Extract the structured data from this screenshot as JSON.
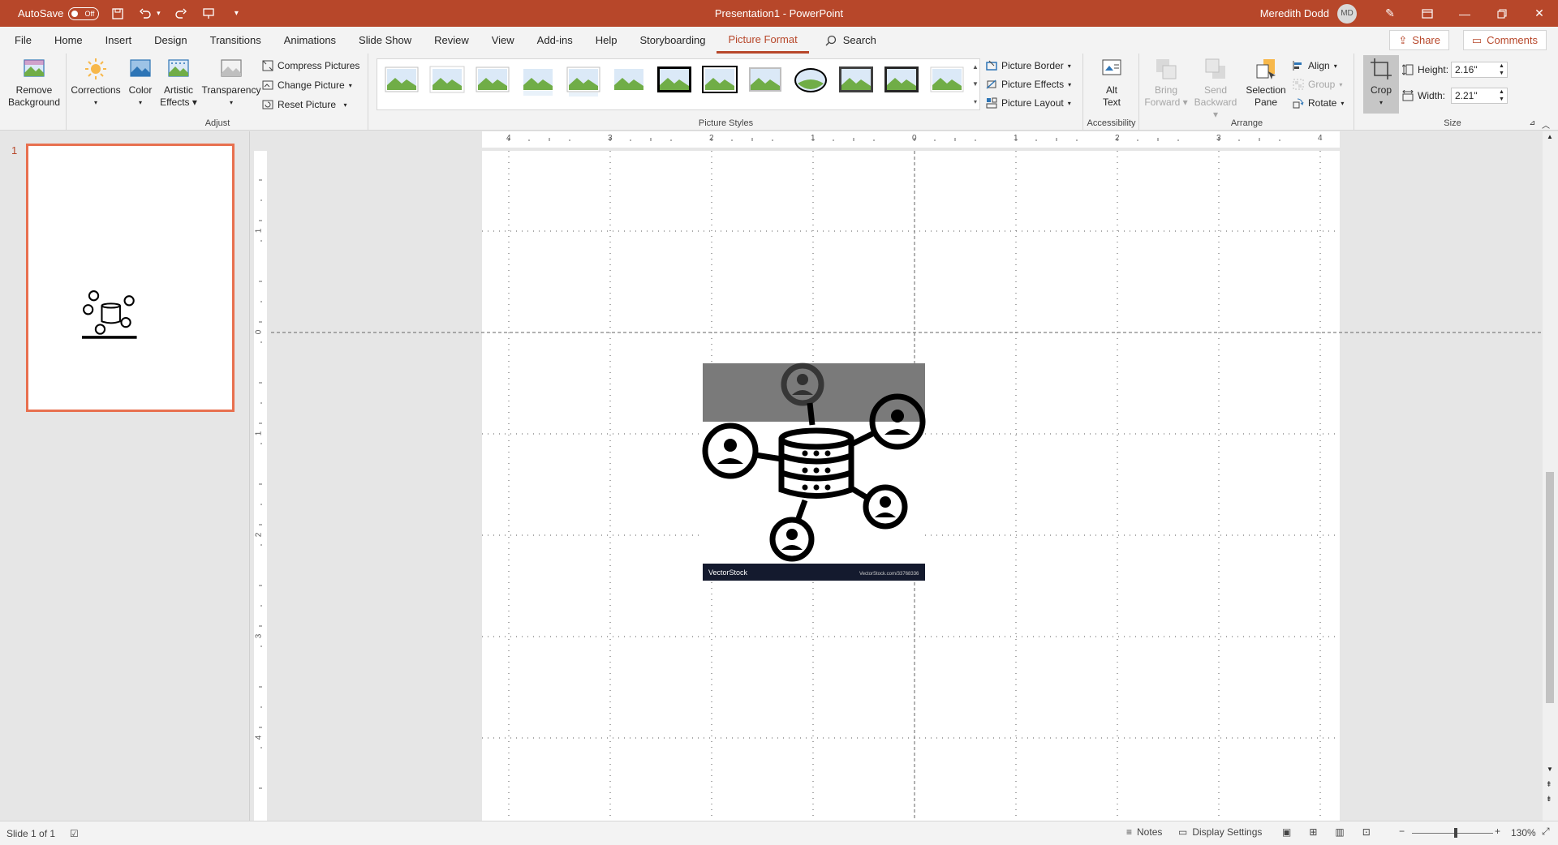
{
  "titlebar": {
    "autosave_label": "AutoSave",
    "autosave_state": "Off",
    "doc_title": "Presentation1  -  PowerPoint",
    "user_name": "Meredith Dodd",
    "user_initials": "MD"
  },
  "tabs": [
    "File",
    "Home",
    "Insert",
    "Design",
    "Transitions",
    "Animations",
    "Slide Show",
    "Review",
    "View",
    "Add-ins",
    "Help",
    "Storyboarding",
    "Picture Format"
  ],
  "active_tab": "Picture Format",
  "search_label": "Search",
  "share_label": "Share",
  "comments_label": "Comments",
  "ribbon": {
    "adjust": {
      "remove_background": [
        "Remove",
        "Background"
      ],
      "corrections": "Corrections",
      "color": "Color",
      "artistic_effects": [
        "Artistic",
        "Effects"
      ],
      "transparency": "Transparency",
      "compress_pictures": "Compress Pictures",
      "change_picture": "Change Picture",
      "reset_picture": "Reset Picture",
      "group_label": "Adjust"
    },
    "picture_styles": {
      "picture_border": "Picture Border",
      "picture_effects": "Picture Effects",
      "picture_layout": "Picture Layout",
      "group_label": "Picture Styles"
    },
    "accessibility": {
      "alt_text": [
        "Alt",
        "Text"
      ],
      "group_label": "Accessibility"
    },
    "arrange": {
      "bring_forward": [
        "Bring",
        "Forward"
      ],
      "send_backward": [
        "Send",
        "Backward"
      ],
      "selection_pane": [
        "Selection",
        "Pane"
      ],
      "align": "Align",
      "group": "Group",
      "rotate": "Rotate",
      "group_label": "Arrange"
    },
    "size": {
      "crop": "Crop",
      "height_label": "Height:",
      "height_value": "2.16\"",
      "width_label": "Width:",
      "width_value": "2.21\"",
      "group_label": "Size"
    }
  },
  "slides": {
    "current_number": "1"
  },
  "ruler": {
    "horizontal_ticks": [
      "4",
      "3",
      "2",
      "1",
      "0",
      "1",
      "2",
      "3",
      "4"
    ],
    "vertical_ticks": [
      "1",
      "0",
      "1",
      "2",
      "3",
      "4"
    ]
  },
  "picture": {
    "watermark_left": "VectorStock",
    "watermark_right": "VectorStock.com/33768336"
  },
  "statusbar": {
    "slide_info": "Slide 1 of 1",
    "notes": "Notes",
    "display_settings": "Display Settings",
    "zoom": "130%"
  },
  "colors": {
    "accent": "#b7472a",
    "thumb_border": "#e8704f"
  }
}
